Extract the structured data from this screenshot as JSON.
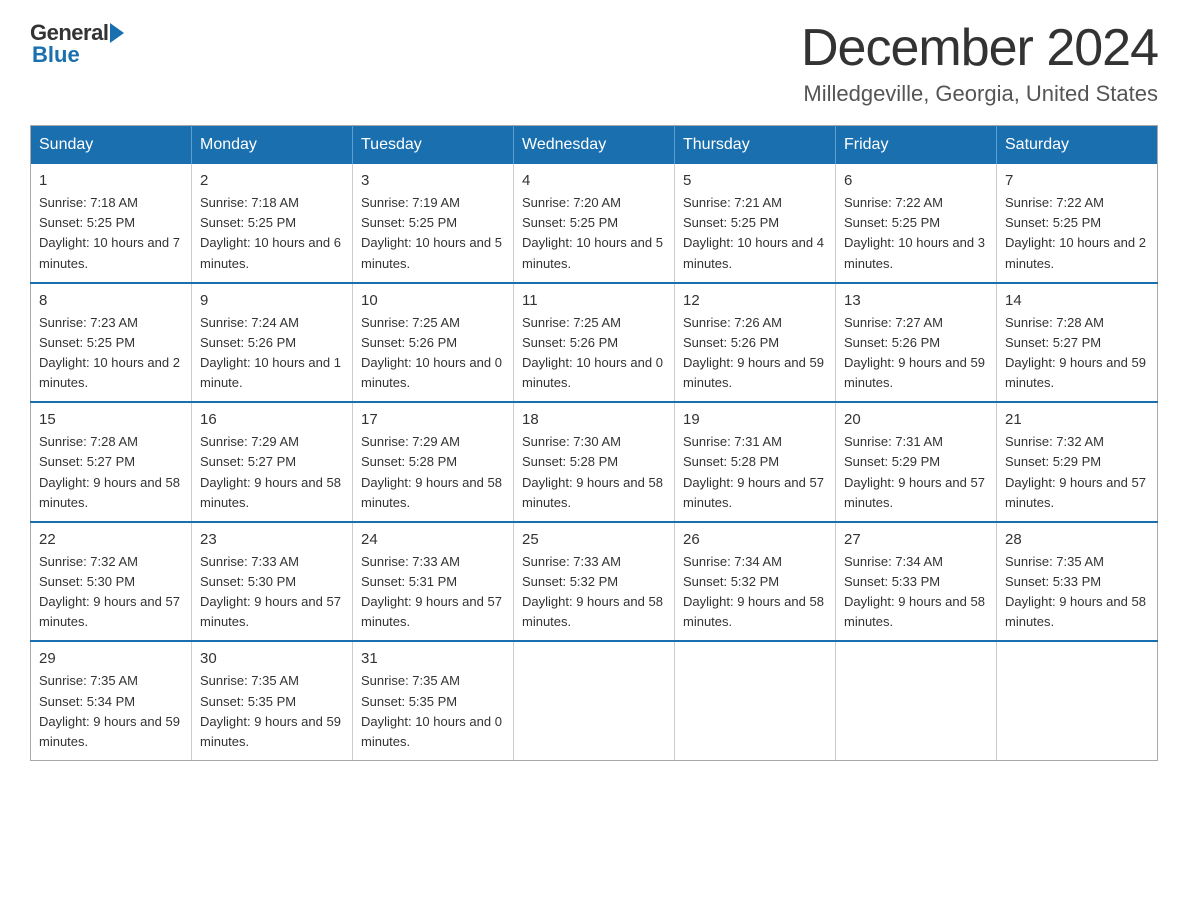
{
  "logo": {
    "general": "General",
    "blue": "Blue"
  },
  "title": "December 2024",
  "subtitle": "Milledgeville, Georgia, United States",
  "weekdays": [
    "Sunday",
    "Monday",
    "Tuesday",
    "Wednesday",
    "Thursday",
    "Friday",
    "Saturday"
  ],
  "weeks": [
    [
      {
        "day": "1",
        "sunrise": "7:18 AM",
        "sunset": "5:25 PM",
        "daylight": "10 hours and 7 minutes."
      },
      {
        "day": "2",
        "sunrise": "7:18 AM",
        "sunset": "5:25 PM",
        "daylight": "10 hours and 6 minutes."
      },
      {
        "day": "3",
        "sunrise": "7:19 AM",
        "sunset": "5:25 PM",
        "daylight": "10 hours and 5 minutes."
      },
      {
        "day": "4",
        "sunrise": "7:20 AM",
        "sunset": "5:25 PM",
        "daylight": "10 hours and 5 minutes."
      },
      {
        "day": "5",
        "sunrise": "7:21 AM",
        "sunset": "5:25 PM",
        "daylight": "10 hours and 4 minutes."
      },
      {
        "day": "6",
        "sunrise": "7:22 AM",
        "sunset": "5:25 PM",
        "daylight": "10 hours and 3 minutes."
      },
      {
        "day": "7",
        "sunrise": "7:22 AM",
        "sunset": "5:25 PM",
        "daylight": "10 hours and 2 minutes."
      }
    ],
    [
      {
        "day": "8",
        "sunrise": "7:23 AM",
        "sunset": "5:25 PM",
        "daylight": "10 hours and 2 minutes."
      },
      {
        "day": "9",
        "sunrise": "7:24 AM",
        "sunset": "5:26 PM",
        "daylight": "10 hours and 1 minute."
      },
      {
        "day": "10",
        "sunrise": "7:25 AM",
        "sunset": "5:26 PM",
        "daylight": "10 hours and 0 minutes."
      },
      {
        "day": "11",
        "sunrise": "7:25 AM",
        "sunset": "5:26 PM",
        "daylight": "10 hours and 0 minutes."
      },
      {
        "day": "12",
        "sunrise": "7:26 AM",
        "sunset": "5:26 PM",
        "daylight": "9 hours and 59 minutes."
      },
      {
        "day": "13",
        "sunrise": "7:27 AM",
        "sunset": "5:26 PM",
        "daylight": "9 hours and 59 minutes."
      },
      {
        "day": "14",
        "sunrise": "7:28 AM",
        "sunset": "5:27 PM",
        "daylight": "9 hours and 59 minutes."
      }
    ],
    [
      {
        "day": "15",
        "sunrise": "7:28 AM",
        "sunset": "5:27 PM",
        "daylight": "9 hours and 58 minutes."
      },
      {
        "day": "16",
        "sunrise": "7:29 AM",
        "sunset": "5:27 PM",
        "daylight": "9 hours and 58 minutes."
      },
      {
        "day": "17",
        "sunrise": "7:29 AM",
        "sunset": "5:28 PM",
        "daylight": "9 hours and 58 minutes."
      },
      {
        "day": "18",
        "sunrise": "7:30 AM",
        "sunset": "5:28 PM",
        "daylight": "9 hours and 58 minutes."
      },
      {
        "day": "19",
        "sunrise": "7:31 AM",
        "sunset": "5:28 PM",
        "daylight": "9 hours and 57 minutes."
      },
      {
        "day": "20",
        "sunrise": "7:31 AM",
        "sunset": "5:29 PM",
        "daylight": "9 hours and 57 minutes."
      },
      {
        "day": "21",
        "sunrise": "7:32 AM",
        "sunset": "5:29 PM",
        "daylight": "9 hours and 57 minutes."
      }
    ],
    [
      {
        "day": "22",
        "sunrise": "7:32 AM",
        "sunset": "5:30 PM",
        "daylight": "9 hours and 57 minutes."
      },
      {
        "day": "23",
        "sunrise": "7:33 AM",
        "sunset": "5:30 PM",
        "daylight": "9 hours and 57 minutes."
      },
      {
        "day": "24",
        "sunrise": "7:33 AM",
        "sunset": "5:31 PM",
        "daylight": "9 hours and 57 minutes."
      },
      {
        "day": "25",
        "sunrise": "7:33 AM",
        "sunset": "5:32 PM",
        "daylight": "9 hours and 58 minutes."
      },
      {
        "day": "26",
        "sunrise": "7:34 AM",
        "sunset": "5:32 PM",
        "daylight": "9 hours and 58 minutes."
      },
      {
        "day": "27",
        "sunrise": "7:34 AM",
        "sunset": "5:33 PM",
        "daylight": "9 hours and 58 minutes."
      },
      {
        "day": "28",
        "sunrise": "7:35 AM",
        "sunset": "5:33 PM",
        "daylight": "9 hours and 58 minutes."
      }
    ],
    [
      {
        "day": "29",
        "sunrise": "7:35 AM",
        "sunset": "5:34 PM",
        "daylight": "9 hours and 59 minutes."
      },
      {
        "day": "30",
        "sunrise": "7:35 AM",
        "sunset": "5:35 PM",
        "daylight": "9 hours and 59 minutes."
      },
      {
        "day": "31",
        "sunrise": "7:35 AM",
        "sunset": "5:35 PM",
        "daylight": "10 hours and 0 minutes."
      },
      null,
      null,
      null,
      null
    ]
  ]
}
